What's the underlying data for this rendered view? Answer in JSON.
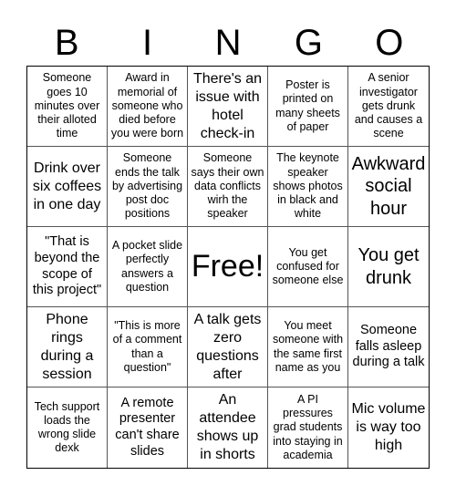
{
  "header": {
    "letters": [
      "B",
      "I",
      "N",
      "G",
      "O"
    ]
  },
  "cells": [
    "Someone goes 10 minutes over their alloted time",
    "Award in memorial of someone who died before you were born",
    "There's an issue with hotel check-in",
    "Poster is printed on many sheets of paper",
    "A senior investigator gets drunk and causes a scene",
    "Drink over six coffees in one day",
    "Someone ends the talk by advertising post doc positions",
    "Someone says their own data conflicts wirh the speaker",
    "The keynote speaker shows photos in black and white",
    "Awkward social hour",
    "\"That is beyond the scope of this project\"",
    "A pocket slide perfectly answers a question",
    "Free!",
    "You get confused for someone else",
    "You get drunk",
    "Phone rings during a session",
    "\"This is more of a comment than a question\"",
    "A talk gets zero questions after",
    "You meet someone with the same first name as you",
    "Someone falls asleep during a talk",
    "Tech support loads the wrong slide dexk",
    "A remote presenter can't share slides",
    "An attendee shows up in shorts",
    "A PI pressures grad students into staying in academia",
    "Mic volume is way too high"
  ]
}
